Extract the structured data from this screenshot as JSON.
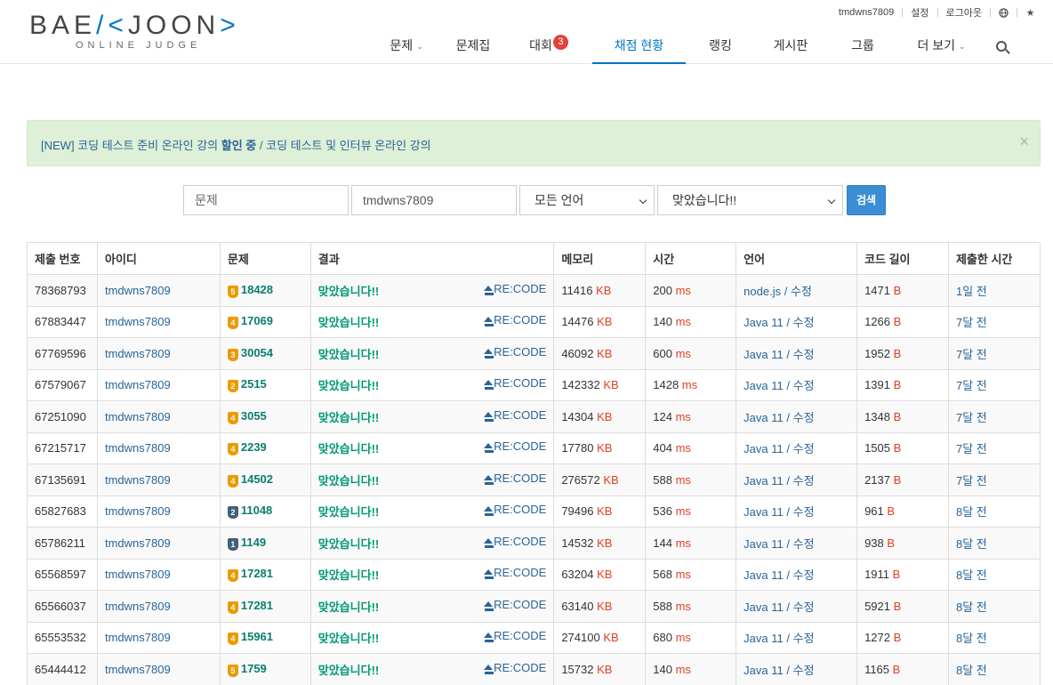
{
  "logo": {
    "main_left": "BAE",
    "main_right": "JOON",
    "sub": "ONLINE JUDGE"
  },
  "topbar": {
    "username": "tmdwns7809",
    "settings": "설정",
    "logout": "로그아웃"
  },
  "nav": {
    "problems": "문제",
    "workbook": "문제집",
    "contest": "대회",
    "contest_badge": "3",
    "status": "채점 현황",
    "ranking": "랭킹",
    "board": "게시판",
    "group": "그룹",
    "more": "더 보기"
  },
  "alert": {
    "prefix": "[NEW] 코딩 테스트 준비 온라인 강의",
    "bold": "할인 중",
    "sep": " / ",
    "suffix": "코딩 테스트 및 인터뷰 온라인 강의",
    "close": "×"
  },
  "filter": {
    "problem_placeholder": "문제",
    "user_value": "tmdwns7809",
    "language": "모든 언어",
    "result": "맞았습니다!!",
    "search_label": "검색"
  },
  "colors": {
    "accent": "#0076c0",
    "correct": "#009874",
    "unit": "#dd4124",
    "gold": "#ec9a00",
    "silver": "#435f7a",
    "bronze": "#ad5600"
  },
  "table": {
    "headers": [
      "제출 번호",
      "아이디",
      "문제",
      "결과",
      "메모리",
      "시간",
      "언어",
      "코드 길이",
      "제출한 시간"
    ],
    "recode_label": "RE:CODE",
    "mem_unit": "KB",
    "time_unit": "ms",
    "len_unit": "B",
    "edit_label": "수정",
    "rows": [
      {
        "id": "78368793",
        "user": "tmdwns7809",
        "tier": "5",
        "tier_color": "#ec9a00",
        "problem": "18428",
        "result": "맞았습니다!!",
        "memory": "11416",
        "time": "200",
        "lang": "node.js",
        "len": "1471",
        "ago": "1일 전"
      },
      {
        "id": "67883447",
        "user": "tmdwns7809",
        "tier": "4",
        "tier_color": "#ec9a00",
        "problem": "17069",
        "result": "맞았습니다!!",
        "memory": "14476",
        "time": "140",
        "lang": "Java 11",
        "len": "1266",
        "ago": "7달 전"
      },
      {
        "id": "67769596",
        "user": "tmdwns7809",
        "tier": "3",
        "tier_color": "#ec9a00",
        "problem": "30054",
        "result": "맞았습니다!!",
        "memory": "46092",
        "time": "600",
        "lang": "Java 11",
        "len": "1952",
        "ago": "7달 전"
      },
      {
        "id": "67579067",
        "user": "tmdwns7809",
        "tier": "2",
        "tier_color": "#ec9a00",
        "problem": "2515",
        "result": "맞았습니다!!",
        "memory": "142332",
        "time": "1428",
        "lang": "Java 11",
        "len": "1391",
        "ago": "7달 전"
      },
      {
        "id": "67251090",
        "user": "tmdwns7809",
        "tier": "4",
        "tier_color": "#ec9a00",
        "problem": "3055",
        "result": "맞았습니다!!",
        "memory": "14304",
        "time": "124",
        "lang": "Java 11",
        "len": "1348",
        "ago": "7달 전"
      },
      {
        "id": "67215717",
        "user": "tmdwns7809",
        "tier": "4",
        "tier_color": "#ec9a00",
        "problem": "2239",
        "result": "맞았습니다!!",
        "memory": "17780",
        "time": "404",
        "lang": "Java 11",
        "len": "1505",
        "ago": "7달 전"
      },
      {
        "id": "67135691",
        "user": "tmdwns7809",
        "tier": "4",
        "tier_color": "#ec9a00",
        "problem": "14502",
        "result": "맞았습니다!!",
        "memory": "276572",
        "time": "588",
        "lang": "Java 11",
        "len": "2137",
        "ago": "7달 전"
      },
      {
        "id": "65827683",
        "user": "tmdwns7809",
        "tier": "2",
        "tier_color": "#435f7a",
        "problem": "11048",
        "result": "맞았습니다!!",
        "memory": "79496",
        "time": "536",
        "lang": "Java 11",
        "len": "961",
        "ago": "8달 전"
      },
      {
        "id": "65786211",
        "user": "tmdwns7809",
        "tier": "1",
        "tier_color": "#435f7a",
        "problem": "1149",
        "result": "맞았습니다!!",
        "memory": "14532",
        "time": "144",
        "lang": "Java 11",
        "len": "938",
        "ago": "8달 전"
      },
      {
        "id": "65568597",
        "user": "tmdwns7809",
        "tier": "4",
        "tier_color": "#ec9a00",
        "problem": "17281",
        "result": "맞았습니다!!",
        "memory": "63204",
        "time": "568",
        "lang": "Java 11",
        "len": "1911",
        "ago": "8달 전"
      },
      {
        "id": "65566037",
        "user": "tmdwns7809",
        "tier": "4",
        "tier_color": "#ec9a00",
        "problem": "17281",
        "result": "맞았습니다!!",
        "memory": "63140",
        "time": "588",
        "lang": "Java 11",
        "len": "5921",
        "ago": "8달 전"
      },
      {
        "id": "65553532",
        "user": "tmdwns7809",
        "tier": "4",
        "tier_color": "#ec9a00",
        "problem": "15961",
        "result": "맞았습니다!!",
        "memory": "274100",
        "time": "680",
        "lang": "Java 11",
        "len": "1272",
        "ago": "8달 전"
      },
      {
        "id": "65444412",
        "user": "tmdwns7809",
        "tier": "5",
        "tier_color": "#ec9a00",
        "problem": "1759",
        "result": "맞았습니다!!",
        "memory": "15732",
        "time": "140",
        "lang": "Java 11",
        "len": "1165",
        "ago": "8달 전"
      }
    ]
  }
}
